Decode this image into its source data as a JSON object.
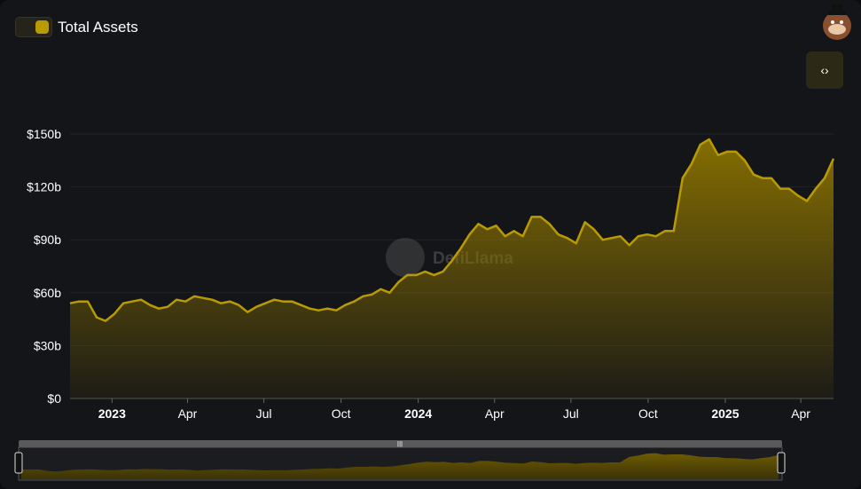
{
  "legend": {
    "label": "Total Assets",
    "color": "#b89b00"
  },
  "embed_button": {
    "label": "‹›"
  },
  "watermark": "DefiLlama",
  "chart_data": {
    "type": "area",
    "title": "Total Assets",
    "ylabel": "",
    "xlabel": "",
    "ylim": [
      0,
      150
    ],
    "y_unit": "billions USD",
    "y_ticks": [
      "$0",
      "$30b",
      "$60b",
      "$90b",
      "$120b",
      "$150b"
    ],
    "y_tick_values": [
      0,
      30,
      60,
      90,
      120,
      150
    ],
    "x_ticks": [
      {
        "label": "2023",
        "date": "2023-01-01",
        "bold": true
      },
      {
        "label": "Apr",
        "date": "2023-04-01"
      },
      {
        "label": "Jul",
        "date": "2023-07-01"
      },
      {
        "label": "Oct",
        "date": "2023-10-01"
      },
      {
        "label": "2024",
        "date": "2024-01-01",
        "bold": true
      },
      {
        "label": "Apr",
        "date": "2024-04-01"
      },
      {
        "label": "Jul",
        "date": "2024-07-01"
      },
      {
        "label": "Oct",
        "date": "2024-10-01"
      },
      {
        "label": "2025",
        "date": "2025-01-01",
        "bold": true
      },
      {
        "label": "Apr",
        "date": "2025-04-01"
      }
    ],
    "x_start": "2022-11-12",
    "x_end": "2025-05-10",
    "grid": true,
    "series": [
      {
        "name": "Total Assets",
        "color": "#b89b00",
        "values": [
          54,
          55,
          55,
          46,
          44,
          48,
          54,
          55,
          56,
          53,
          51,
          52,
          56,
          55,
          58,
          57,
          56,
          54,
          55,
          53,
          49,
          52,
          54,
          56,
          55,
          55,
          53,
          51,
          50,
          51,
          50,
          53,
          55,
          58,
          59,
          62,
          60,
          66,
          70,
          70,
          72,
          70,
          72,
          78,
          85,
          93,
          99,
          96,
          98,
          92,
          95,
          92,
          103,
          103,
          99,
          93,
          91,
          88,
          100,
          96,
          90,
          91,
          92,
          87,
          92,
          93,
          92,
          95,
          95,
          125,
          133,
          144,
          147,
          138,
          140,
          140,
          135,
          127,
          125,
          125,
          119,
          119,
          115,
          112,
          119,
          125,
          136
        ]
      }
    ]
  }
}
